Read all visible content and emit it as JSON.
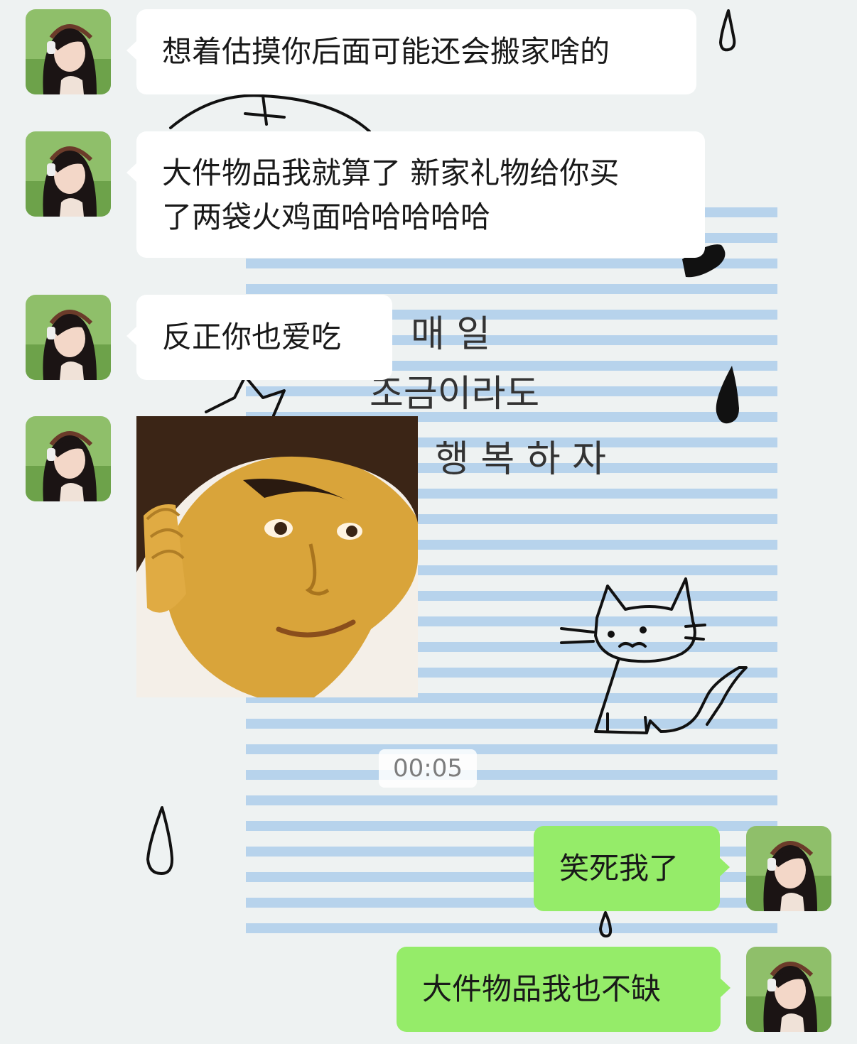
{
  "wallpaper": {
    "korean_text": [
      "매 일",
      "조금이라도",
      "행 복 하 자"
    ],
    "stripe_color": "#b7d3ec",
    "line_color": "#111111"
  },
  "messages": [
    {
      "side": "received",
      "type": "text",
      "text": "想着估摸你后面可能还会搬家啥的"
    },
    {
      "side": "received",
      "type": "text",
      "text": "大件物品我就算了 新家礼物给你买\n了两袋火鸡面哈哈哈哈哈"
    },
    {
      "side": "received",
      "type": "text",
      "text": "反正你也爱吃"
    },
    {
      "side": "received",
      "type": "sticker",
      "sticker": "smirking-face-sticker"
    },
    {
      "side": "sent",
      "type": "text",
      "text": "笑死我了"
    },
    {
      "side": "sent",
      "type": "text",
      "text": "大件物品我也不缺"
    }
  ],
  "timestamp": "00:05",
  "colors": {
    "background": "#eef2f2",
    "received_bubble": "#ffffff",
    "sent_bubble": "#95ec69",
    "text": "#191919",
    "timestamp_text": "#7d7d7d"
  },
  "icons": {
    "avatar_contact": "girl-with-headphones-avatar",
    "avatar_self": "girl-with-headphones-avatar"
  }
}
